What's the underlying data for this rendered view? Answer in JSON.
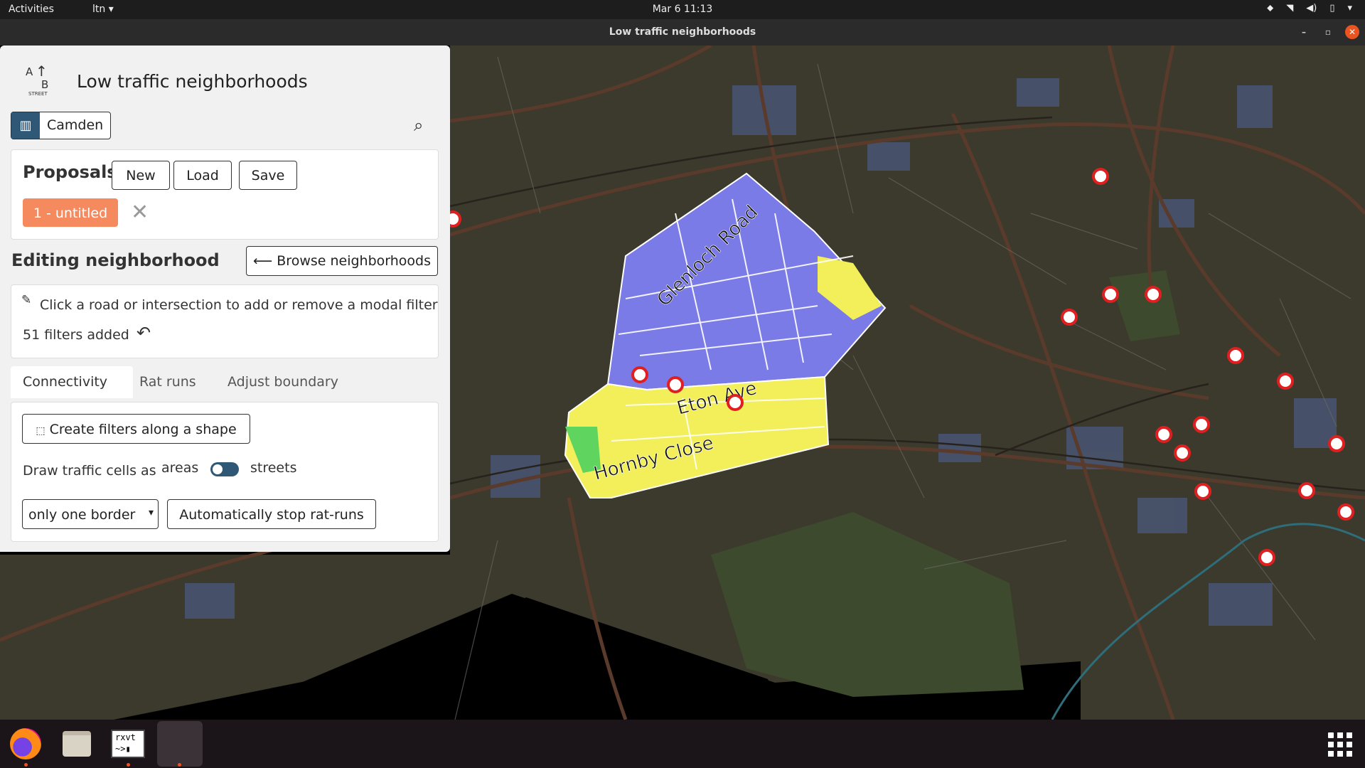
{
  "topbar": {
    "activities": "Activities",
    "app_menu": "ltn",
    "clock": "Mar 6  11:13"
  },
  "window": {
    "title": "Low traffic neighborhoods"
  },
  "panel": {
    "logo_text": "STREET",
    "logo_letters": [
      "A",
      "B"
    ],
    "app_title": "Low traffic neighborhoods",
    "city": "Camden",
    "proposals": {
      "heading": "Proposals",
      "new": "New",
      "load": "Load",
      "save": "Save",
      "current": "1 - untitled"
    },
    "editing": {
      "heading": "Editing neighborhood",
      "browse": "Browse neighborhoods",
      "instruction": "Click a road or intersection to add or remove a modal filter",
      "filters_added": "51 filters added"
    },
    "tabs": [
      "Connectivity",
      "Rat runs",
      "Adjust boundary"
    ],
    "connectivity": {
      "create_filters": "Create filters along a shape",
      "draw_cells_label": "Draw traffic cells as",
      "toggle_left": "areas",
      "toggle_right": "streets",
      "border_select": "only one border",
      "auto_stop": "Automatically stop rat-runs"
    }
  },
  "map": {
    "street_labels": [
      "Glenloch Road",
      "Eton Ave",
      "Hornby Close"
    ],
    "colors": {
      "background": "#3a3a2c",
      "area_blue": "#7b7be8",
      "area_yellow": "#f2ef5a",
      "area_green": "#5fd45f",
      "filter_marker": "#e02020",
      "accent": "#f58a5f"
    }
  },
  "dock": {
    "items": [
      "firefox-icon",
      "files-icon",
      "terminal-icon",
      "active-app-icon",
      "app-grid-icon"
    ],
    "terminal_label": "rxvt"
  }
}
